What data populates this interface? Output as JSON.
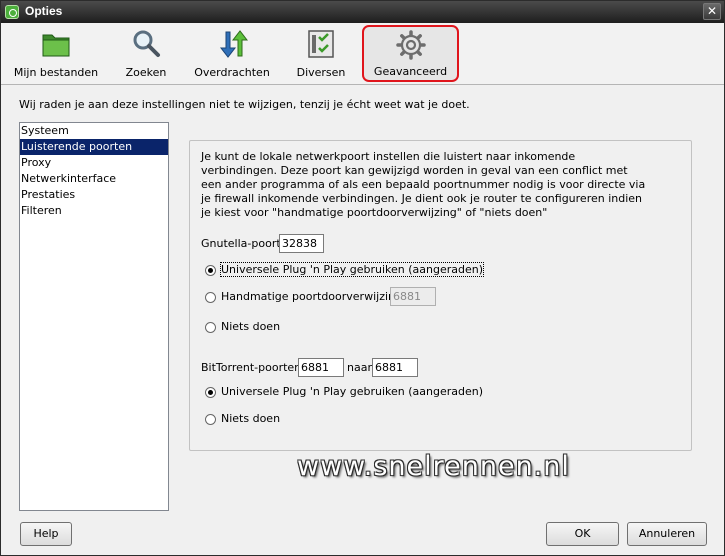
{
  "window": {
    "title": "Opties",
    "close_symbol": "✕"
  },
  "toolbar": {
    "items": [
      {
        "label": "Mijn bestanden",
        "icon": "folder-icon"
      },
      {
        "label": "Zoeken",
        "icon": "magnifier-icon"
      },
      {
        "label": "Overdrachten",
        "icon": "transfer-arrows-icon"
      },
      {
        "label": "Diversen",
        "icon": "checklist-icon"
      },
      {
        "label": "Geavanceerd",
        "icon": "gear-icon",
        "selected": true
      }
    ]
  },
  "warning_text": "Wij raden je aan deze instellingen niet te wijzigen, tenzij je écht weet wat je doet.",
  "categories": [
    {
      "label": "Systeem"
    },
    {
      "label": "Luisterende poorten",
      "selected": true
    },
    {
      "label": "Proxy"
    },
    {
      "label": "Netwerkinterface"
    },
    {
      "label": "Prestaties"
    },
    {
      "label": "Filteren"
    }
  ],
  "panel": {
    "description": "Je kunt de lokale netwerkpoort instellen die luistert naar inkomende verbindingen. Deze poort kan gewijzigd worden in geval van een conflict met een ander programma of als een bepaald poortnummer nodig is voor directe via je firewall inkomende verbindingen. Je dient ook je router te configureren indien je kiest voor \"handmatige poortdoorverwijzing\" of \"niets doen\"",
    "gnutella": {
      "label": "Gnutella-poort:",
      "value": "32838",
      "options": [
        {
          "label": "Universele Plug 'n Play gebruiken (aangeraden)",
          "checked": true
        },
        {
          "label": "Handmatige poortdoorverwijzing:",
          "checked": false,
          "field_value": "6881"
        },
        {
          "label": "Niets doen",
          "checked": false
        }
      ]
    },
    "bittorrent": {
      "label": "BitTorrent-poorten:",
      "from_value": "6881",
      "to_label": "naar",
      "to_value": "6881",
      "options": [
        {
          "label": "Universele Plug 'n Play gebruiken (aangeraden)",
          "checked": true
        },
        {
          "label": "Niets doen",
          "checked": false
        }
      ]
    }
  },
  "watermark": "www.snelrennen.nl",
  "buttons": {
    "help": "Help",
    "ok": "OK",
    "cancel": "Annuleren"
  },
  "colors": {
    "selection": "#0a246a",
    "highlight_border": "#e0151c"
  }
}
